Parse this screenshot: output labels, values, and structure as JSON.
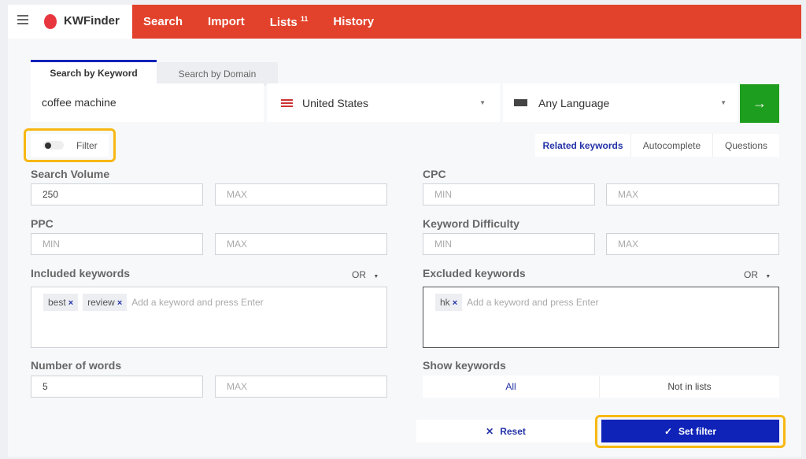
{
  "app": {
    "brand": "KWFinder",
    "nav": [
      {
        "label": "Search"
      },
      {
        "label": "Import"
      },
      {
        "label": "Lists",
        "badge": "11"
      },
      {
        "label": "History"
      }
    ]
  },
  "search": {
    "tabs": [
      "Search by Keyword",
      "Search by Domain"
    ],
    "keyword": "coffee machine",
    "location": "United States",
    "language": "Any Language",
    "go_icon": "arrow-right-icon"
  },
  "filter": {
    "label": "Filter",
    "enabled": false
  },
  "modes": [
    "Related keywords",
    "Autocomplete",
    "Questions"
  ],
  "fields": {
    "search_volume": {
      "label": "Search Volume",
      "min": "250",
      "max_ph": "MAX"
    },
    "cpc": {
      "label": "CPC",
      "min_ph": "MIN",
      "max_ph": "MAX"
    },
    "ppc": {
      "label": "PPC",
      "min_ph": "MIN",
      "max_ph": "MAX"
    },
    "kd": {
      "label": "Keyword Difficulty",
      "min_ph": "MIN",
      "max_ph": "MAX"
    },
    "included": {
      "label": "Included keywords",
      "op": "OR",
      "chips": [
        "best",
        "review"
      ],
      "placeholder": "Add a keyword and press Enter"
    },
    "excluded": {
      "label": "Excluded keywords",
      "op": "OR",
      "chips": [
        "hk"
      ],
      "placeholder": "Add a keyword and press Enter"
    },
    "words": {
      "label": "Number of words",
      "min": "5",
      "max_ph": "MAX"
    },
    "show": {
      "label": "Show keywords",
      "options": [
        "All",
        "Not in lists"
      ]
    }
  },
  "actions": {
    "reset": "Reset",
    "set": "Set filter"
  },
  "colors": {
    "brand_red": "#e2422b",
    "go_green": "#1e9e1e",
    "accent_blue": "#0f23b8",
    "highlight": "#f7b813"
  }
}
